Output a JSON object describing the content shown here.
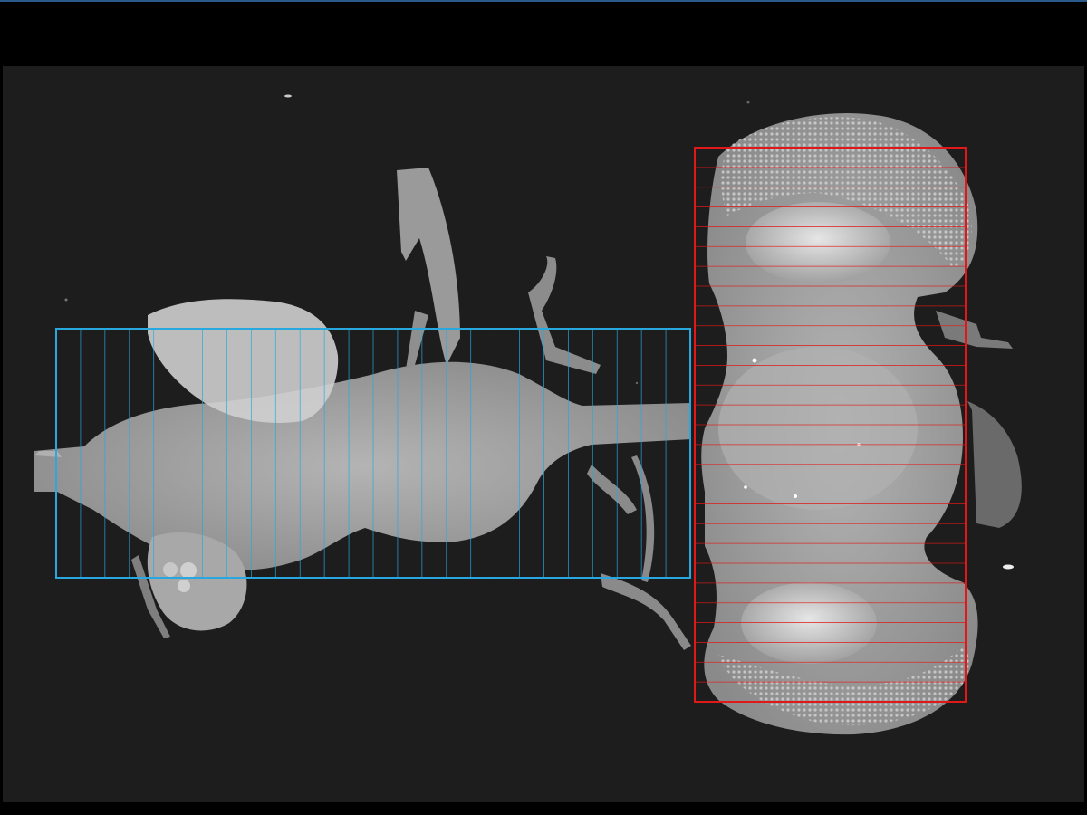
{
  "viewer": {
    "background_color": "#1d1d1d",
    "frame_color": "#000000",
    "specimen": "brain-and-ventral-nerve-cord-volume-render"
  },
  "overlays": {
    "slice_boxes": [
      {
        "id": "ventral-nerve-cord-slices",
        "color": "#29a8e0",
        "orientation": "vertical-lines"
      },
      {
        "id": "brain-slices",
        "color": "#e01818",
        "orientation": "horizontal-lines"
      }
    ]
  }
}
